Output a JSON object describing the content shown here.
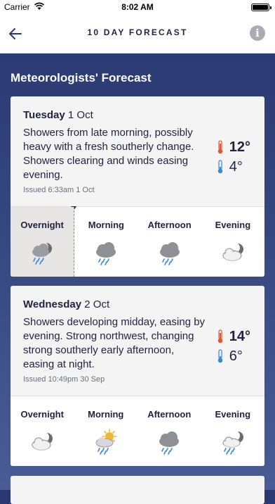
{
  "status": {
    "carrier": "Carrier",
    "time": "8:02 AM"
  },
  "nav": {
    "title": "10 DAY FORECAST",
    "info_label": "i"
  },
  "section_title": "Meteorologists' Forecast",
  "days": [
    {
      "day": "Tuesday",
      "date": "1 Oct",
      "description": "Showers from late morning, possibly heavy with a fresh southerly change. Showers clearing and winds easing evening.",
      "issued": "Issued 6:33am 1 Oct",
      "max": "12°",
      "min": "4°",
      "periods": [
        {
          "label": "Overnight",
          "icon": "moon-cloud-rain-icon",
          "current": true
        },
        {
          "label": "Morning",
          "icon": "cloud-rain-icon"
        },
        {
          "label": "Afternoon",
          "icon": "cloud-rain-icon"
        },
        {
          "label": "Evening",
          "icon": "moon-cloud-icon"
        }
      ]
    },
    {
      "day": "Wednesday",
      "date": "2 Oct",
      "description": "Showers developing midday, easing by evening. Strong northwest, changing strong southerly early afternoon, easing at night.",
      "issued": "Issued 10:49pm 30 Sep",
      "max": "14°",
      "min": "6°",
      "periods": [
        {
          "label": "Overnight",
          "icon": "moon-cloud-icon"
        },
        {
          "label": "Morning",
          "icon": "sun-cloud-rain-icon"
        },
        {
          "label": "Afternoon",
          "icon": "cloud-rain-icon"
        },
        {
          "label": "Evening",
          "icon": "moon-cloud-rain-icon"
        }
      ]
    }
  ],
  "colors": {
    "accent": "#2a3770",
    "max_temp": "#e0552b",
    "min_temp": "#3a86d6"
  }
}
